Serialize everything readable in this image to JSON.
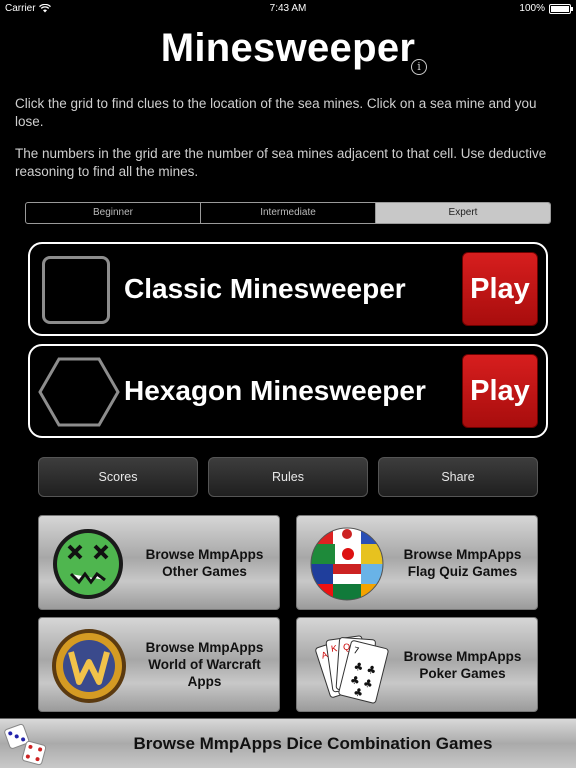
{
  "status": {
    "carrier": "Carrier",
    "time": "7:43 AM",
    "battery": "100%",
    "battery_level": 1.0
  },
  "header": {
    "title": "Minesweeper",
    "info_glyph": "i"
  },
  "description": {
    "p1": "Click the grid to find clues to the location of the sea mines. Click on a sea mine and you lose.",
    "p2": "The numbers in the grid are the number of sea mines adjacent to that cell. Use deductive reasoning to find all the mines."
  },
  "difficulty": {
    "options": [
      "Beginner",
      "Intermediate",
      "Expert"
    ],
    "selected": "Expert"
  },
  "games": [
    {
      "label": "Classic Minesweeper",
      "play_label": "Play",
      "icon": "square-grid-icon"
    },
    {
      "label": "Hexagon Minesweeper",
      "play_label": "Play",
      "icon": "hexagon-icon"
    }
  ],
  "utilities": {
    "scores": "Scores",
    "rules": "Rules",
    "share": "Share"
  },
  "promos": [
    {
      "line1": "Browse MmpApps",
      "line2": "Other Games",
      "line3": "",
      "icon": "zombie-face-icon"
    },
    {
      "line1": "Browse MmpApps",
      "line2": "Flag Quiz Games",
      "line3": "",
      "icon": "flag-globe-icon"
    },
    {
      "line1": "Browse MmpApps",
      "line2": "World of Warcraft",
      "line3": "Apps",
      "icon": "warcraft-shield-icon"
    },
    {
      "line1": "Browse MmpApps",
      "line2": "Poker Games",
      "line3": "",
      "icon": "playing-cards-icon"
    }
  ],
  "bottom": {
    "label": "Browse MmpApps Dice Combination Games",
    "icon": "dice-icon"
  },
  "colors": {
    "play": "#c01515",
    "segment_selected": "#c8c8c8",
    "background": "#000000"
  }
}
